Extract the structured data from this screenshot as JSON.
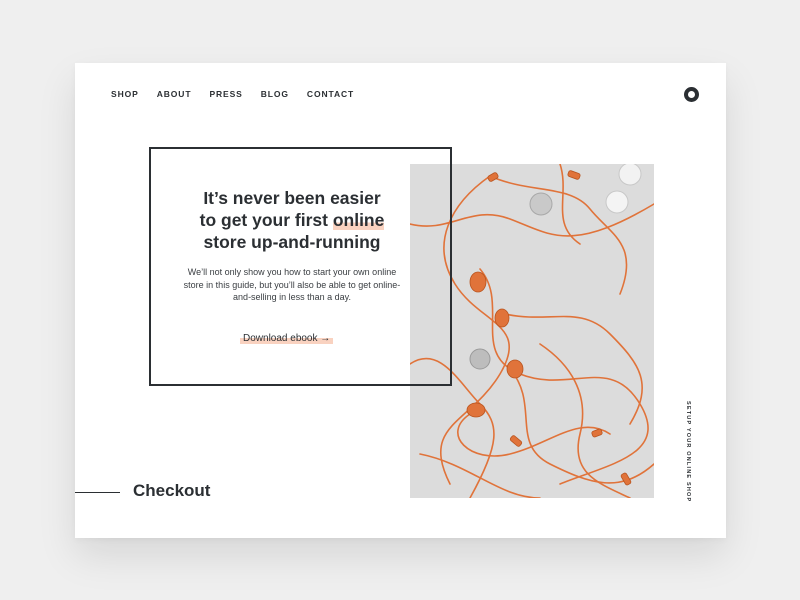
{
  "nav": {
    "items": [
      "SHOP",
      "ABOUT",
      "PRESS",
      "BLOG",
      "CONTACT"
    ]
  },
  "logo": {
    "icon": "circle-logo-icon"
  },
  "hero": {
    "headline_line1": "It’s never been easier",
    "headline_line2_pre": "to get your first ",
    "headline_line2_highlight": "online",
    "headline_line3": "store up-and-running",
    "body": "We’ll not only show you how to start your own online store in this guide, but you’ll also be able to get online-and-selling in less than a day.",
    "cta_label": "Download ebook →"
  },
  "section_title": "Checkout",
  "side_label": "SETUP YOUR ONLINE SHOP",
  "colors": {
    "ink": "#2b2f33",
    "accent_highlight": "#f9d2c0",
    "cable": "#e0733a",
    "background": "#efefef"
  }
}
